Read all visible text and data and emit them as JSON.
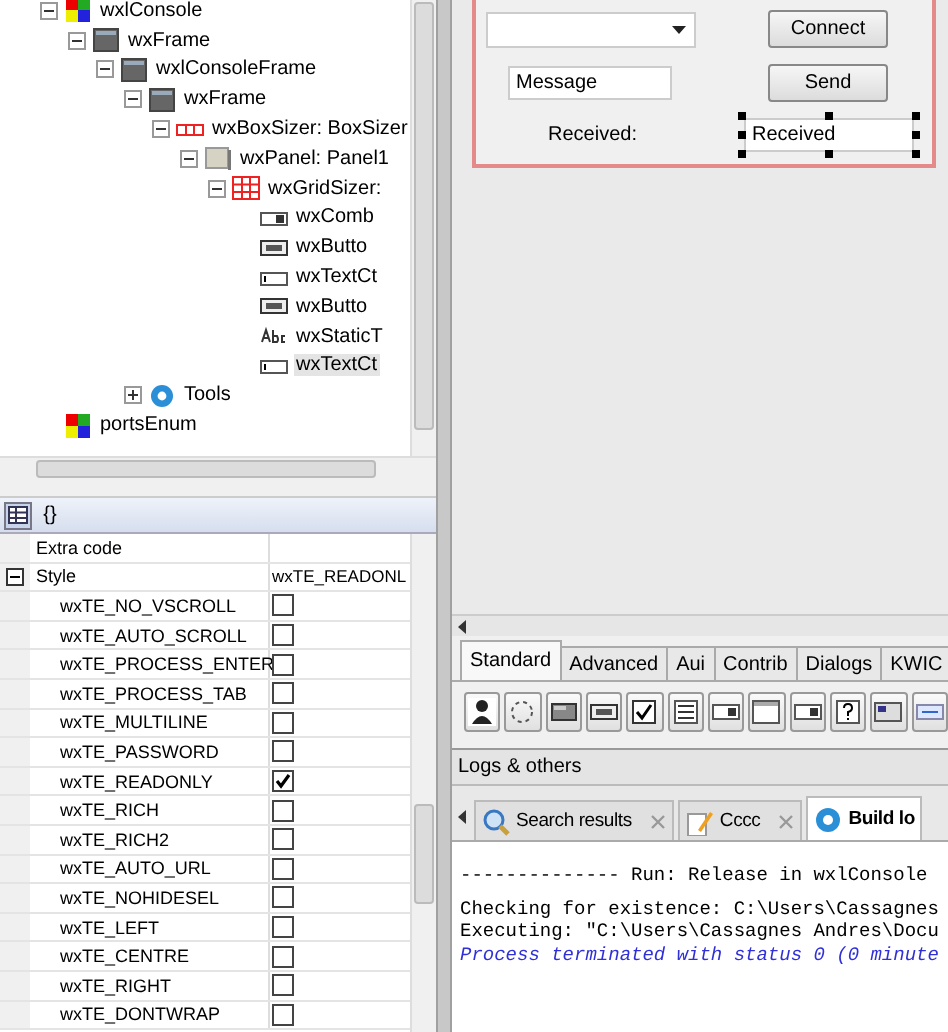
{
  "tree": {
    "items": [
      {
        "label": "wxlConsole",
        "kind": "app",
        "expanded": true,
        "selected": false,
        "children": [
          {
            "label": "wxFrame",
            "kind": "frame",
            "expanded": true,
            "selected": false,
            "children": [
              {
                "label": "wxlConsoleFrame",
                "kind": "frame",
                "expanded": true,
                "selected": false,
                "children": [
                  {
                    "label": "wxFrame",
                    "kind": "frame",
                    "expanded": true,
                    "selected": false,
                    "children": [
                      {
                        "label": "wxBoxSizer: BoxSizer",
                        "kind": "boxsizer",
                        "expanded": true,
                        "selected": false,
                        "children": [
                          {
                            "label": "wxPanel: Panel1",
                            "kind": "panel",
                            "expanded": true,
                            "selected": false,
                            "children": [
                              {
                                "label": "wxGridSizer:",
                                "kind": "gridsizer",
                                "expanded": true,
                                "selected": false,
                                "children": [
                                  {
                                    "label": "wxComb",
                                    "kind": "combo",
                                    "selected": false
                                  },
                                  {
                                    "label": "wxButto",
                                    "kind": "button",
                                    "selected": false
                                  },
                                  {
                                    "label": "wxTextCt",
                                    "kind": "text",
                                    "selected": false
                                  },
                                  {
                                    "label": "wxButto",
                                    "kind": "button",
                                    "selected": false
                                  },
                                  {
                                    "label": "wxStaticT",
                                    "kind": "static",
                                    "selected": false
                                  },
                                  {
                                    "label": "wxTextCt",
                                    "kind": "text",
                                    "selected": true
                                  }
                                ]
                              }
                            ]
                          }
                        ]
                      }
                    ]
                  },
                  {
                    "label": "Tools",
                    "kind": "tools",
                    "expanded": false,
                    "selected": false
                  }
                ]
              }
            ]
          }
        ]
      },
      {
        "label": "portsEnum",
        "kind": "app",
        "selected": false
      }
    ]
  },
  "props": {
    "view_tabs": [
      {
        "kind": "grid",
        "selected": true
      },
      {
        "kind": "code",
        "label": "{}",
        "selected": false
      }
    ],
    "rows": [
      {
        "kind": "text",
        "name": "Extra code"
      },
      {
        "kind": "group",
        "name": "Style",
        "value": "wxTE_READONL",
        "expanded": true
      },
      {
        "kind": "flag",
        "name": "wxTE_NO_VSCROLL",
        "checked": false
      },
      {
        "kind": "flag",
        "name": "wxTE_AUTO_SCROLL",
        "checked": false
      },
      {
        "kind": "flag",
        "name": "wxTE_PROCESS_ENTER",
        "checked": false
      },
      {
        "kind": "flag",
        "name": "wxTE_PROCESS_TAB",
        "checked": false
      },
      {
        "kind": "flag",
        "name": "wxTE_MULTILINE",
        "checked": false
      },
      {
        "kind": "flag",
        "name": "wxTE_PASSWORD",
        "checked": false
      },
      {
        "kind": "flag",
        "name": "wxTE_READONLY",
        "checked": true
      },
      {
        "kind": "flag",
        "name": "wxTE_RICH",
        "checked": false
      },
      {
        "kind": "flag",
        "name": "wxTE_RICH2",
        "checked": false
      },
      {
        "kind": "flag",
        "name": "wxTE_AUTO_URL",
        "checked": false
      },
      {
        "kind": "flag",
        "name": "wxTE_NOHIDESEL",
        "checked": false
      },
      {
        "kind": "flag",
        "name": "wxTE_LEFT",
        "checked": false
      },
      {
        "kind": "flag",
        "name": "wxTE_CENTRE",
        "checked": false
      },
      {
        "kind": "flag",
        "name": "wxTE_RIGHT",
        "checked": false
      },
      {
        "kind": "flag",
        "name": "wxTE_DONTWRAP",
        "checked": false
      }
    ]
  },
  "form": {
    "controls": [
      {
        "kind": "combo",
        "selected": false
      },
      {
        "kind": "button",
        "label": "Connect",
        "selected": false
      },
      {
        "kind": "field",
        "value": "Message",
        "selected": false
      },
      {
        "kind": "button",
        "label": "Send",
        "selected": false
      },
      {
        "kind": "label",
        "label": "Received:",
        "selected": false
      },
      {
        "kind": "field",
        "value": "Received",
        "selected": true
      }
    ]
  },
  "palette": {
    "tabs": [
      {
        "label": "Standard",
        "selected": true
      },
      {
        "label": "Advanced",
        "selected": false
      },
      {
        "label": "Aui",
        "selected": false
      },
      {
        "label": "Contrib",
        "selected": false
      },
      {
        "label": "Dialogs",
        "selected": false
      },
      {
        "label": "KWIC",
        "selected": false
      }
    ]
  },
  "logs": {
    "title": "Logs & others",
    "tabs": [
      {
        "label": "Search results",
        "kind": "search",
        "closable": true,
        "selected": false
      },
      {
        "label": "Cccc",
        "kind": "edit",
        "closable": true,
        "selected": false
      },
      {
        "label": "Build lo",
        "kind": "build",
        "closable": false,
        "selected": true
      }
    ],
    "lines": [
      {
        "kind": "header",
        "text": "-------------- Run: Release in wxlConsole"
      },
      {
        "kind": "plain",
        "text": "Checking for existence: C:\\Users\\Cassagnes"
      },
      {
        "kind": "plain",
        "text": "Executing: \"C:\\Users\\Cassagnes Andres\\Docu"
      },
      {
        "kind": "status",
        "text": "Process terminated with status 0 (0 minute"
      }
    ]
  }
}
